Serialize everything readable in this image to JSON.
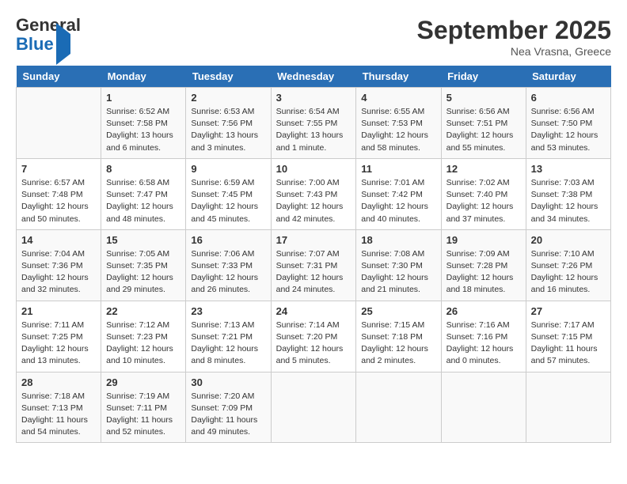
{
  "header": {
    "logo_line1": "General",
    "logo_line2": "Blue",
    "month": "September 2025",
    "location": "Nea Vrasna, Greece"
  },
  "days_of_week": [
    "Sunday",
    "Monday",
    "Tuesday",
    "Wednesday",
    "Thursday",
    "Friday",
    "Saturday"
  ],
  "weeks": [
    [
      {
        "day": "",
        "text": ""
      },
      {
        "day": "1",
        "text": "Sunrise: 6:52 AM\nSunset: 7:58 PM\nDaylight: 13 hours\nand 6 minutes."
      },
      {
        "day": "2",
        "text": "Sunrise: 6:53 AM\nSunset: 7:56 PM\nDaylight: 13 hours\nand 3 minutes."
      },
      {
        "day": "3",
        "text": "Sunrise: 6:54 AM\nSunset: 7:55 PM\nDaylight: 13 hours\nand 1 minute."
      },
      {
        "day": "4",
        "text": "Sunrise: 6:55 AM\nSunset: 7:53 PM\nDaylight: 12 hours\nand 58 minutes."
      },
      {
        "day": "5",
        "text": "Sunrise: 6:56 AM\nSunset: 7:51 PM\nDaylight: 12 hours\nand 55 minutes."
      },
      {
        "day": "6",
        "text": "Sunrise: 6:56 AM\nSunset: 7:50 PM\nDaylight: 12 hours\nand 53 minutes."
      }
    ],
    [
      {
        "day": "7",
        "text": "Sunrise: 6:57 AM\nSunset: 7:48 PM\nDaylight: 12 hours\nand 50 minutes."
      },
      {
        "day": "8",
        "text": "Sunrise: 6:58 AM\nSunset: 7:47 PM\nDaylight: 12 hours\nand 48 minutes."
      },
      {
        "day": "9",
        "text": "Sunrise: 6:59 AM\nSunset: 7:45 PM\nDaylight: 12 hours\nand 45 minutes."
      },
      {
        "day": "10",
        "text": "Sunrise: 7:00 AM\nSunset: 7:43 PM\nDaylight: 12 hours\nand 42 minutes."
      },
      {
        "day": "11",
        "text": "Sunrise: 7:01 AM\nSunset: 7:42 PM\nDaylight: 12 hours\nand 40 minutes."
      },
      {
        "day": "12",
        "text": "Sunrise: 7:02 AM\nSunset: 7:40 PM\nDaylight: 12 hours\nand 37 minutes."
      },
      {
        "day": "13",
        "text": "Sunrise: 7:03 AM\nSunset: 7:38 PM\nDaylight: 12 hours\nand 34 minutes."
      }
    ],
    [
      {
        "day": "14",
        "text": "Sunrise: 7:04 AM\nSunset: 7:36 PM\nDaylight: 12 hours\nand 32 minutes."
      },
      {
        "day": "15",
        "text": "Sunrise: 7:05 AM\nSunset: 7:35 PM\nDaylight: 12 hours\nand 29 minutes."
      },
      {
        "day": "16",
        "text": "Sunrise: 7:06 AM\nSunset: 7:33 PM\nDaylight: 12 hours\nand 26 minutes."
      },
      {
        "day": "17",
        "text": "Sunrise: 7:07 AM\nSunset: 7:31 PM\nDaylight: 12 hours\nand 24 minutes."
      },
      {
        "day": "18",
        "text": "Sunrise: 7:08 AM\nSunset: 7:30 PM\nDaylight: 12 hours\nand 21 minutes."
      },
      {
        "day": "19",
        "text": "Sunrise: 7:09 AM\nSunset: 7:28 PM\nDaylight: 12 hours\nand 18 minutes."
      },
      {
        "day": "20",
        "text": "Sunrise: 7:10 AM\nSunset: 7:26 PM\nDaylight: 12 hours\nand 16 minutes."
      }
    ],
    [
      {
        "day": "21",
        "text": "Sunrise: 7:11 AM\nSunset: 7:25 PM\nDaylight: 12 hours\nand 13 minutes."
      },
      {
        "day": "22",
        "text": "Sunrise: 7:12 AM\nSunset: 7:23 PM\nDaylight: 12 hours\nand 10 minutes."
      },
      {
        "day": "23",
        "text": "Sunrise: 7:13 AM\nSunset: 7:21 PM\nDaylight: 12 hours\nand 8 minutes."
      },
      {
        "day": "24",
        "text": "Sunrise: 7:14 AM\nSunset: 7:20 PM\nDaylight: 12 hours\nand 5 minutes."
      },
      {
        "day": "25",
        "text": "Sunrise: 7:15 AM\nSunset: 7:18 PM\nDaylight: 12 hours\nand 2 minutes."
      },
      {
        "day": "26",
        "text": "Sunrise: 7:16 AM\nSunset: 7:16 PM\nDaylight: 12 hours\nand 0 minutes."
      },
      {
        "day": "27",
        "text": "Sunrise: 7:17 AM\nSunset: 7:15 PM\nDaylight: 11 hours\nand 57 minutes."
      }
    ],
    [
      {
        "day": "28",
        "text": "Sunrise: 7:18 AM\nSunset: 7:13 PM\nDaylight: 11 hours\nand 54 minutes."
      },
      {
        "day": "29",
        "text": "Sunrise: 7:19 AM\nSunset: 7:11 PM\nDaylight: 11 hours\nand 52 minutes."
      },
      {
        "day": "30",
        "text": "Sunrise: 7:20 AM\nSunset: 7:09 PM\nDaylight: 11 hours\nand 49 minutes."
      },
      {
        "day": "",
        "text": ""
      },
      {
        "day": "",
        "text": ""
      },
      {
        "day": "",
        "text": ""
      },
      {
        "day": "",
        "text": ""
      }
    ]
  ]
}
